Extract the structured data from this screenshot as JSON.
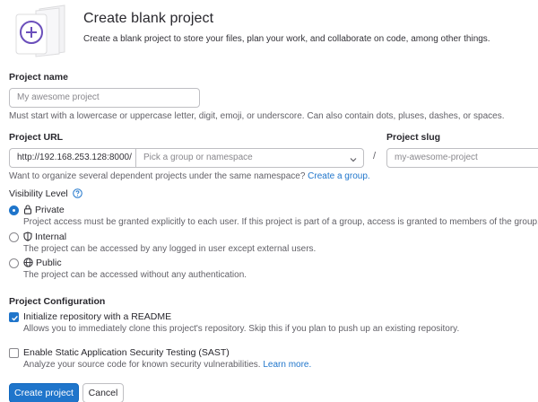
{
  "header": {
    "title": "Create blank project",
    "description": "Create a blank project to store your files, plan your work, and collaborate on code, among other things."
  },
  "project_name": {
    "label": "Project name",
    "placeholder": "My awesome project",
    "help": "Must start with a lowercase or uppercase letter, digit, emoji, or underscore. Can also contain dots, pluses, dashes, or spaces."
  },
  "project_url": {
    "label": "Project URL",
    "prefix": "http://192.168.253.128:8000/",
    "namespace_placeholder": "Pick a group or namespace",
    "separator": "/",
    "help": "Want to organize several dependent projects under the same namespace?",
    "help_link": "Create a group."
  },
  "project_slug": {
    "label": "Project slug",
    "placeholder": "my-awesome-project"
  },
  "visibility": {
    "label": "Visibility Level",
    "options": [
      {
        "label": "Private",
        "icon": "lock-icon",
        "selected": true,
        "help": "Project access must be granted explicitly to each user. If this project is part of a group, access is granted to members of the group."
      },
      {
        "label": "Internal",
        "icon": "shield-icon",
        "selected": false,
        "help": "The project can be accessed by any logged in user except external users."
      },
      {
        "label": "Public",
        "icon": "earth-icon",
        "selected": false,
        "help": "The project can be accessed without any authentication."
      }
    ]
  },
  "configuration": {
    "label": "Project Configuration",
    "readme": {
      "label": "Initialize repository with a README",
      "checked": true,
      "help": "Allows you to immediately clone this project's repository. Skip this if you plan to push up an existing repository."
    },
    "sast": {
      "label": "Enable Static Application Security Testing (SAST)",
      "checked": false,
      "help": "Analyze your source code for known security vulnerabilities.",
      "help_link": "Learn more."
    }
  },
  "buttons": {
    "create": "Create project",
    "cancel": "Cancel"
  },
  "colors": {
    "accent": "#1f75cb",
    "illustration_purple": "#6b4fbb"
  }
}
